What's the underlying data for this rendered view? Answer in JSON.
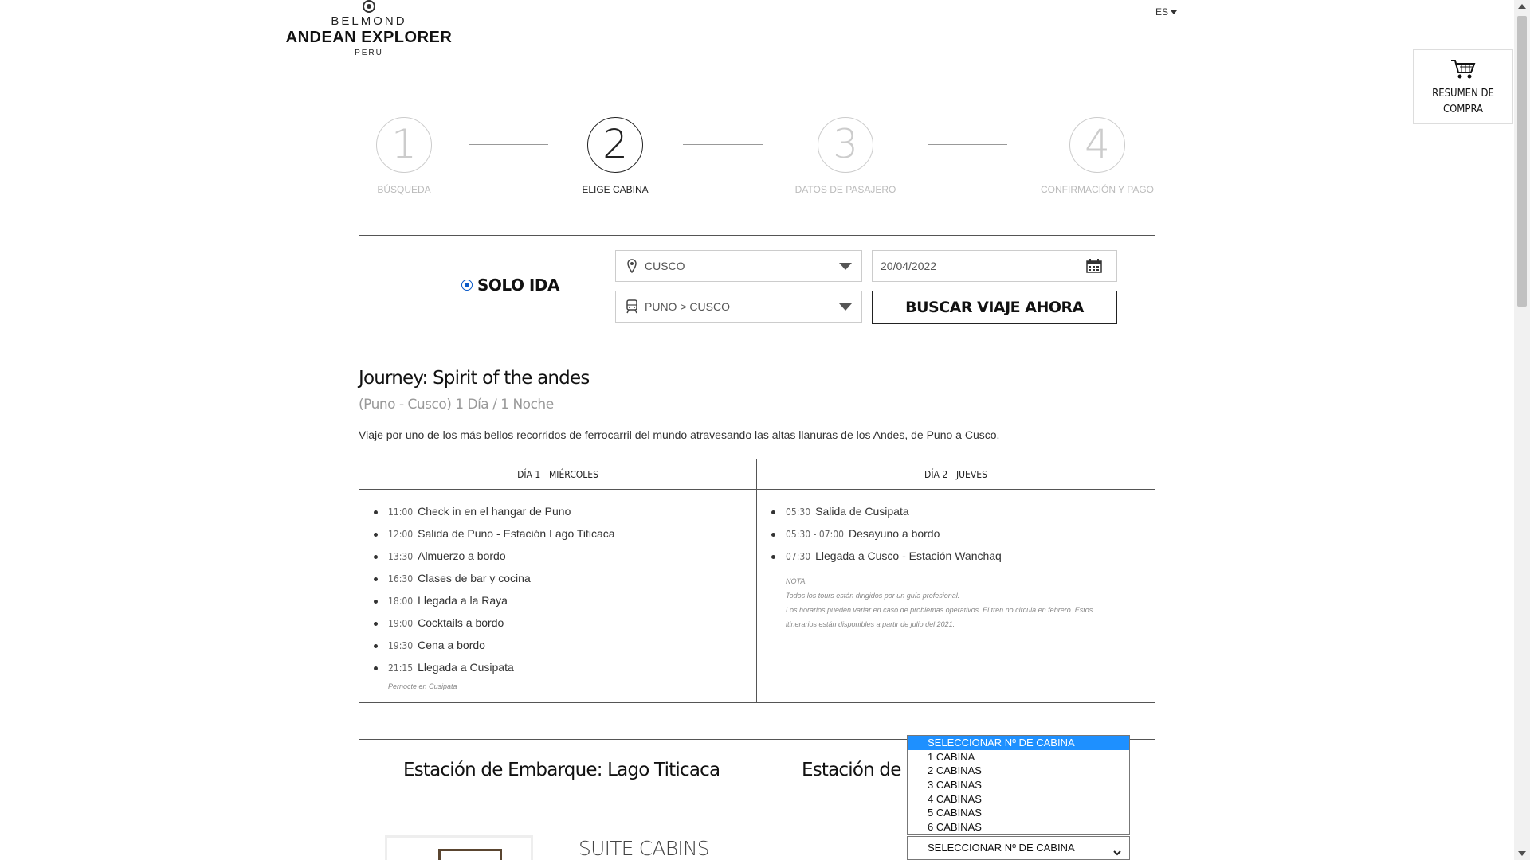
{
  "header": {
    "brand_top": "BELMOND",
    "brand_main": "ANDEAN EXPLORER",
    "brand_sub": "PERU",
    "language": "ES",
    "cart_label_line1": "RESUMEN DE",
    "cart_label_line2": "COMPRA"
  },
  "steps": [
    {
      "number": "1",
      "label": "BÚSQUEDA",
      "state": "done"
    },
    {
      "number": "2",
      "label": "ELIGE CABINA",
      "state": "active"
    },
    {
      "number": "3",
      "label": "DATOS DE PASAJERO",
      "state": "pending"
    },
    {
      "number": "4",
      "label": "CONFIRMACIÓN Y PAGO",
      "state": "pending"
    }
  ],
  "search": {
    "trip_type_label": "SOLO IDA",
    "origin": "CUSCO",
    "route": "PUNO > CUSCO",
    "date": "20/04/2022",
    "button_label": "BUSCAR VIAJE AHORA"
  },
  "journey": {
    "title": "Journey: Spirit of the andes",
    "subtitle": "(Puno - Cusco) 1 Día / 1 Noche",
    "description": "Viaje por uno de los más bellos recorridos de ferrocarril del mundo atravesando las altas llanuras de los Andes, de Puno a Cusco."
  },
  "itinerary": {
    "day1": {
      "header": "DÍA 1 - MIÉRCOLES",
      "items": [
        {
          "time": "11:00",
          "text": "Check in en el hangar de Puno"
        },
        {
          "time": "12:00",
          "text": "Salida de Puno - Estación Lago Titicaca"
        },
        {
          "time": "13:30",
          "text": "Almuerzo a bordo"
        },
        {
          "time": "16:30",
          "text": "Clases de bar y cocina"
        },
        {
          "time": "18:00",
          "text": "Llegada a la Raya"
        },
        {
          "time": "19:00",
          "text": "Cocktails a bordo"
        },
        {
          "time": "19:30",
          "text": "Cena a bordo"
        },
        {
          "time": "21:15",
          "text": "Llegada a Cusipata"
        }
      ],
      "note": "Pernocte en Cusipata"
    },
    "day2": {
      "header": "DÍA 2 - JUEVES",
      "items": [
        {
          "time": "05:30",
          "text": "Salida de Cusipata"
        },
        {
          "time": "05:30 - 07:00",
          "text": "Desayuno a bordo"
        },
        {
          "time": "07:30",
          "text": "Llegada a Cusco - Estación Wanchaq"
        }
      ],
      "note_title": "NOTA:",
      "note_line1": "Todos los tours están dirigidos por un guía profesional.",
      "note_line2": "Los horarios pueden variar en caso de problemas operativos. El tren no circula en febrero. Estos itinerarios están disponibles a partir de julio del 2021."
    }
  },
  "stations": {
    "boarding": "Estación de Embarque: Lago Titicaca",
    "alighting": "Estación de Desembarque: Wanchaq"
  },
  "suite": {
    "title": "SUITE CABINS"
  },
  "cabin_select": {
    "options": [
      "SELECCIONAR Nº DE CABINA",
      "1 CABINA",
      "2 CABINAS",
      "3 CABINAS",
      "4 CABINAS",
      "5 CABINAS",
      "6 CABINAS"
    ],
    "selected": "SELECCIONAR Nº DE CABINA"
  }
}
